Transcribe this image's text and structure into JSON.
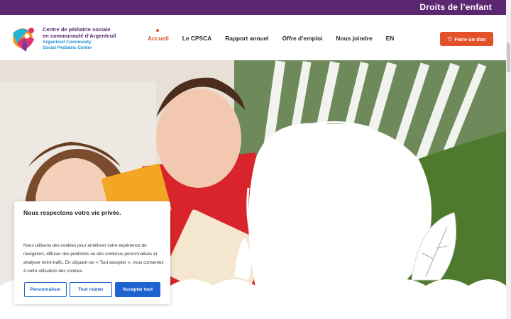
{
  "topbar": {
    "rights_link": "Droits de l’enfant",
    "background": "#5b2770"
  },
  "logo": {
    "line1": "Centre de pédiatrie sociale",
    "line2": "en communauté d’Argenteuil",
    "line3": "Argenteuil Community",
    "line4": "Social Pediatric Center"
  },
  "nav": {
    "items": [
      {
        "label": "Accueil",
        "active": true
      },
      {
        "label": "Le CPSCA",
        "active": false
      },
      {
        "label": "Rapport annuel",
        "active": false
      },
      {
        "label": "Offre d’emploi",
        "active": false
      },
      {
        "label": "Nous joindre",
        "active": false
      },
      {
        "label": "EN",
        "active": false
      }
    ]
  },
  "donate": {
    "label": "Faire un don",
    "icon": "heart-icon",
    "color": "#e2512a"
  },
  "cookie_banner": {
    "title": "Nous respectons votre vie privée.",
    "body": "Nous utilisons des cookies pour améliorer votre expérience de navigation, diffuser des publicités ou des contenus personnalisés et analyser notre trafic. En cliquant sur « Tout accepter », vous consentez à notre utilisation des cookies.",
    "customize": "Personnaliser",
    "reject_all": "Tout rejeter",
    "accept_all": "Accepter tout"
  },
  "colors": {
    "accent": "#e05a2b",
    "primary_blue": "#1f63d1",
    "brand_purple": "#5b2770"
  }
}
